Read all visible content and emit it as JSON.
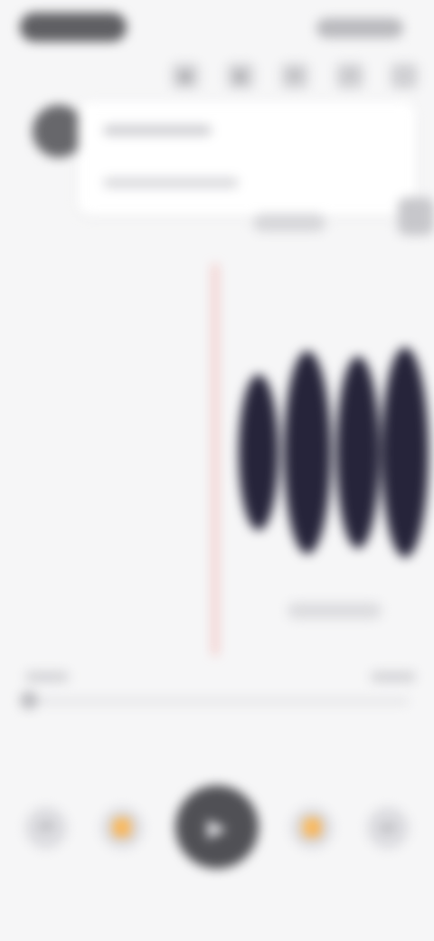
{
  "header": {
    "toolbar_icons": [
      "tag-icon",
      "bookmark-icon",
      "mic-icon",
      "share-icon",
      "more-icon"
    ]
  },
  "recording": {
    "playhead_color": "#f2a8a4",
    "waveform_color": "#26243a"
  },
  "controls": {
    "icons": [
      "skip-back-icon",
      "rewind-icon",
      "play-icon",
      "forward-icon",
      "skip-forward-icon"
    ]
  }
}
